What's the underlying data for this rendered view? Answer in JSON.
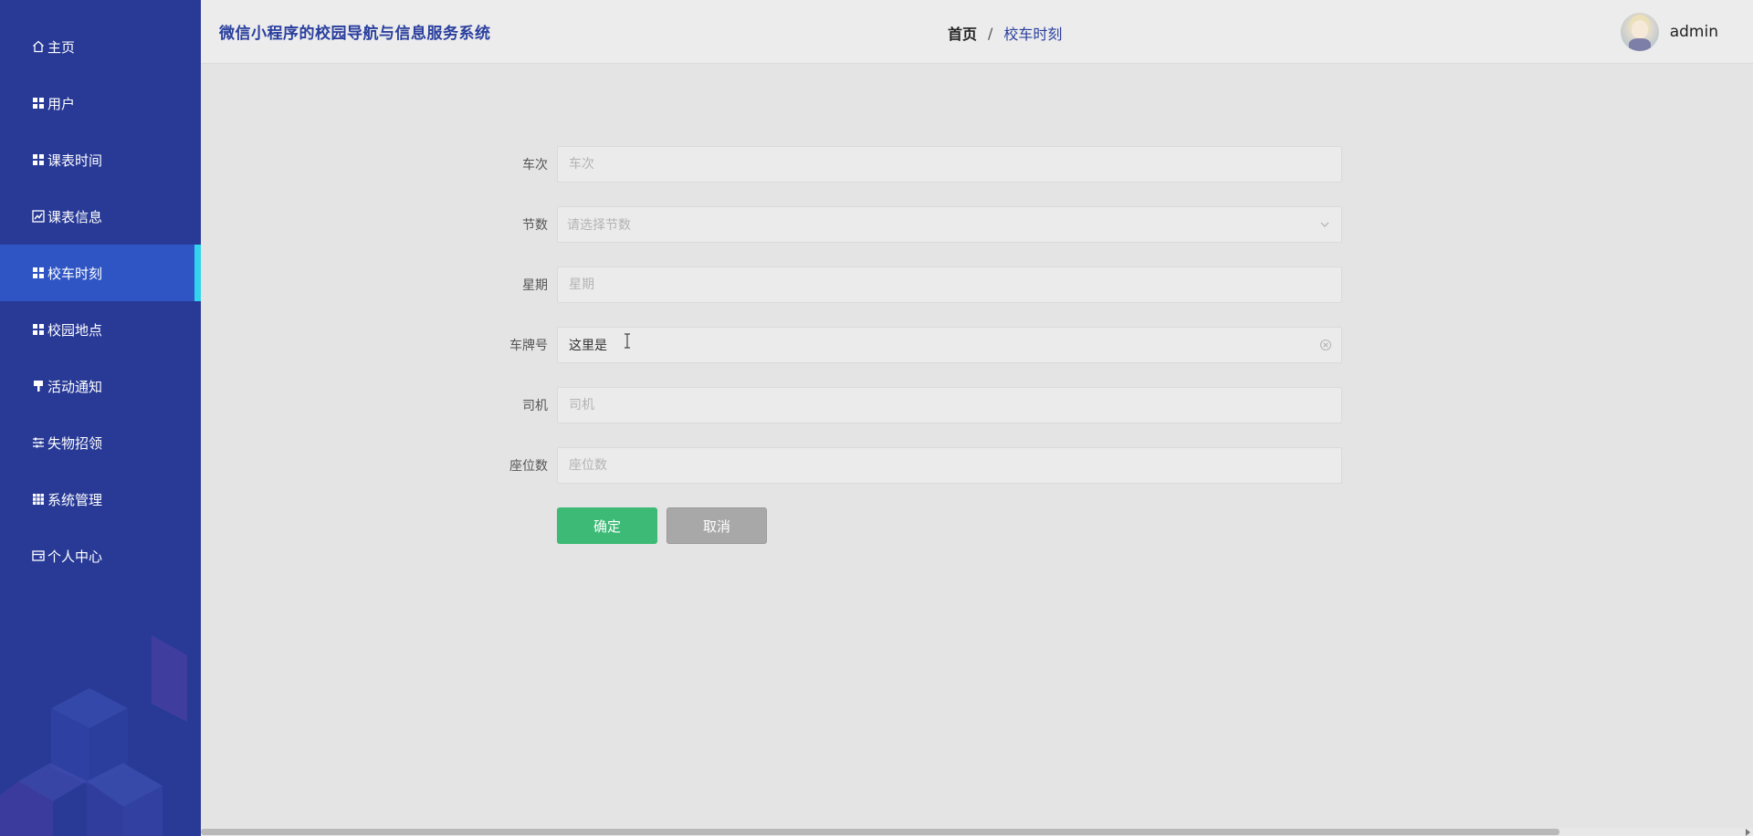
{
  "app": {
    "title": "微信小程序的校园导航与信息服务系统"
  },
  "sidebar": {
    "items": [
      {
        "label": "主页",
        "icon": "home-icon"
      },
      {
        "label": "用户",
        "icon": "grid-icon"
      },
      {
        "label": "课表时间",
        "icon": "grid-icon"
      },
      {
        "label": "课表信息",
        "icon": "chart-icon"
      },
      {
        "label": "校车时刻",
        "icon": "grid-icon",
        "active": true
      },
      {
        "label": "校园地点",
        "icon": "grid-icon"
      },
      {
        "label": "活动通知",
        "icon": "brush-icon"
      },
      {
        "label": "失物招领",
        "icon": "sliders-icon"
      },
      {
        "label": "系统管理",
        "icon": "apps-icon"
      },
      {
        "label": "个人中心",
        "icon": "card-icon"
      }
    ]
  },
  "header": {
    "breadcrumb_home": "首页",
    "breadcrumb_sep": "/",
    "breadcrumb_current": "校车时刻",
    "username": "admin"
  },
  "form": {
    "fields": [
      {
        "label": "车次",
        "placeholder": "车次",
        "value": ""
      },
      {
        "label": "节数",
        "placeholder": "请选择节数",
        "value": ""
      },
      {
        "label": "星期",
        "placeholder": "星期",
        "value": ""
      },
      {
        "label": "车牌号",
        "placeholder": "",
        "value": "这里是"
      },
      {
        "label": "司机",
        "placeholder": "司机",
        "value": ""
      },
      {
        "label": "座位数",
        "placeholder": "座位数",
        "value": ""
      }
    ],
    "confirm_label": "确定",
    "cancel_label": "取消"
  },
  "colors": {
    "sidebar_bg": "#283a96",
    "sidebar_active": "#2f55c4",
    "active_marker": "#31d3ee",
    "confirm": "#3dbb76",
    "cancel": "#a8a8a8",
    "title": "#2a3f9e"
  }
}
